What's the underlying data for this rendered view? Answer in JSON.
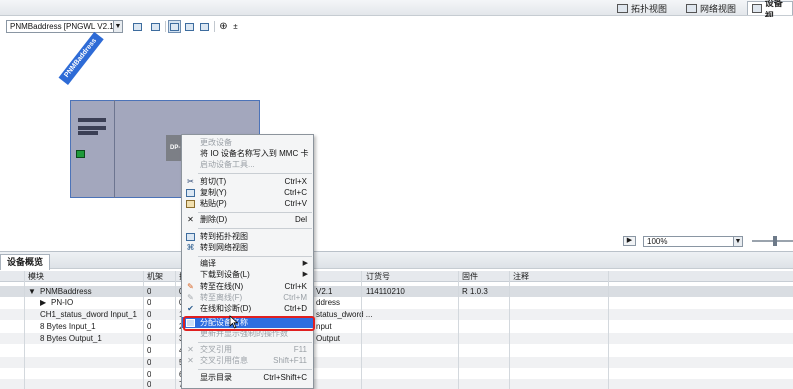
{
  "view_tabs": [
    {
      "label": "拓扑视图"
    },
    {
      "label": "网络视图"
    },
    {
      "label": "设备视"
    }
  ],
  "toolbar": {
    "device_select": "PNMBaddress [PNGWL V2.1]"
  },
  "canvas": {
    "device_name_tag": "PNMBaddress",
    "dp_module_label": "DP-"
  },
  "zoom": {
    "value": "100%"
  },
  "overview": {
    "title": "设备概览",
    "columns": [
      "模块",
      "机架",
      "插",
      "",
      "订货号",
      "固件",
      "注释"
    ],
    "rows": [
      {
        "module": "PNMBaddress",
        "rack": "0",
        "slot": "0",
        "type": "V2.1",
        "order": "114110210",
        "fw": "R 1.0.3"
      },
      {
        "module": "PN-IO",
        "rack": "0",
        "slot": "0",
        "type": "ddress",
        "order": "",
        "fw": ""
      },
      {
        "module": "CH1_status_dword Input_1",
        "rack": "0",
        "slot": "1",
        "type": "status_dword ...",
        "order": "",
        "fw": ""
      },
      {
        "module": "8 Bytes Input_1",
        "rack": "0",
        "slot": "2",
        "type": "nput",
        "order": "",
        "fw": ""
      },
      {
        "module": "8 Bytes Output_1",
        "rack": "0",
        "slot": "3",
        "type": "Output",
        "order": "",
        "fw": ""
      },
      {
        "module": "",
        "rack": "0",
        "slot": "4",
        "type": "",
        "order": "",
        "fw": ""
      },
      {
        "module": "",
        "rack": "0",
        "slot": "5",
        "type": "",
        "order": "",
        "fw": ""
      },
      {
        "module": "",
        "rack": "0",
        "slot": "6",
        "type": "",
        "order": "",
        "fw": ""
      },
      {
        "module": "",
        "rack": "0",
        "slot": "7",
        "type": "",
        "order": "",
        "fw": ""
      }
    ]
  },
  "context_menu": {
    "items": [
      {
        "label": "更改设备",
        "shortcut": "",
        "disabled": true
      },
      {
        "label": "将 IO 设备名称写入到 MMC 卡",
        "shortcut": "",
        "disabled": false
      },
      {
        "label": "启动设备工具...",
        "shortcut": "",
        "disabled": true
      },
      {
        "label": "剪切(T)",
        "shortcut": "Ctrl+X",
        "disabled": false
      },
      {
        "label": "复制(Y)",
        "shortcut": "Ctrl+C",
        "disabled": false
      },
      {
        "label": "粘贴(P)",
        "shortcut": "Ctrl+V",
        "disabled": false
      },
      {
        "label": "删除(D)",
        "shortcut": "Del",
        "disabled": false
      },
      {
        "label": "转到拓扑视图",
        "shortcut": "",
        "disabled": false
      },
      {
        "label": "转到网络视图",
        "shortcut": "",
        "disabled": false
      },
      {
        "label": "编译",
        "shortcut": "",
        "disabled": false
      },
      {
        "label": "下载到设备(L)",
        "shortcut": "",
        "disabled": false
      },
      {
        "label": "转至在线(N)",
        "shortcut": "Ctrl+K",
        "disabled": false
      },
      {
        "label": "转至离线(F)",
        "shortcut": "Ctrl+M",
        "disabled": true
      },
      {
        "label": "在线和诊断(D)",
        "shortcut": "Ctrl+D",
        "disabled": false
      },
      {
        "label": "分配设备名称",
        "shortcut": "",
        "disabled": false
      },
      {
        "label": "更新并显示强制的操作数",
        "shortcut": "",
        "disabled": true
      },
      {
        "label": "交叉引用",
        "shortcut": "F11",
        "disabled": true
      },
      {
        "label": "交叉引用信息",
        "shortcut": "Shift+F11",
        "disabled": true
      },
      {
        "label": "显示目录",
        "shortcut": "Ctrl+Shift+C",
        "disabled": false
      }
    ]
  },
  "colors": {
    "rack": "#a3a7bd",
    "tag": "#2e6bd6",
    "highlight": "#2f6ee0",
    "outline": "#e02020"
  }
}
